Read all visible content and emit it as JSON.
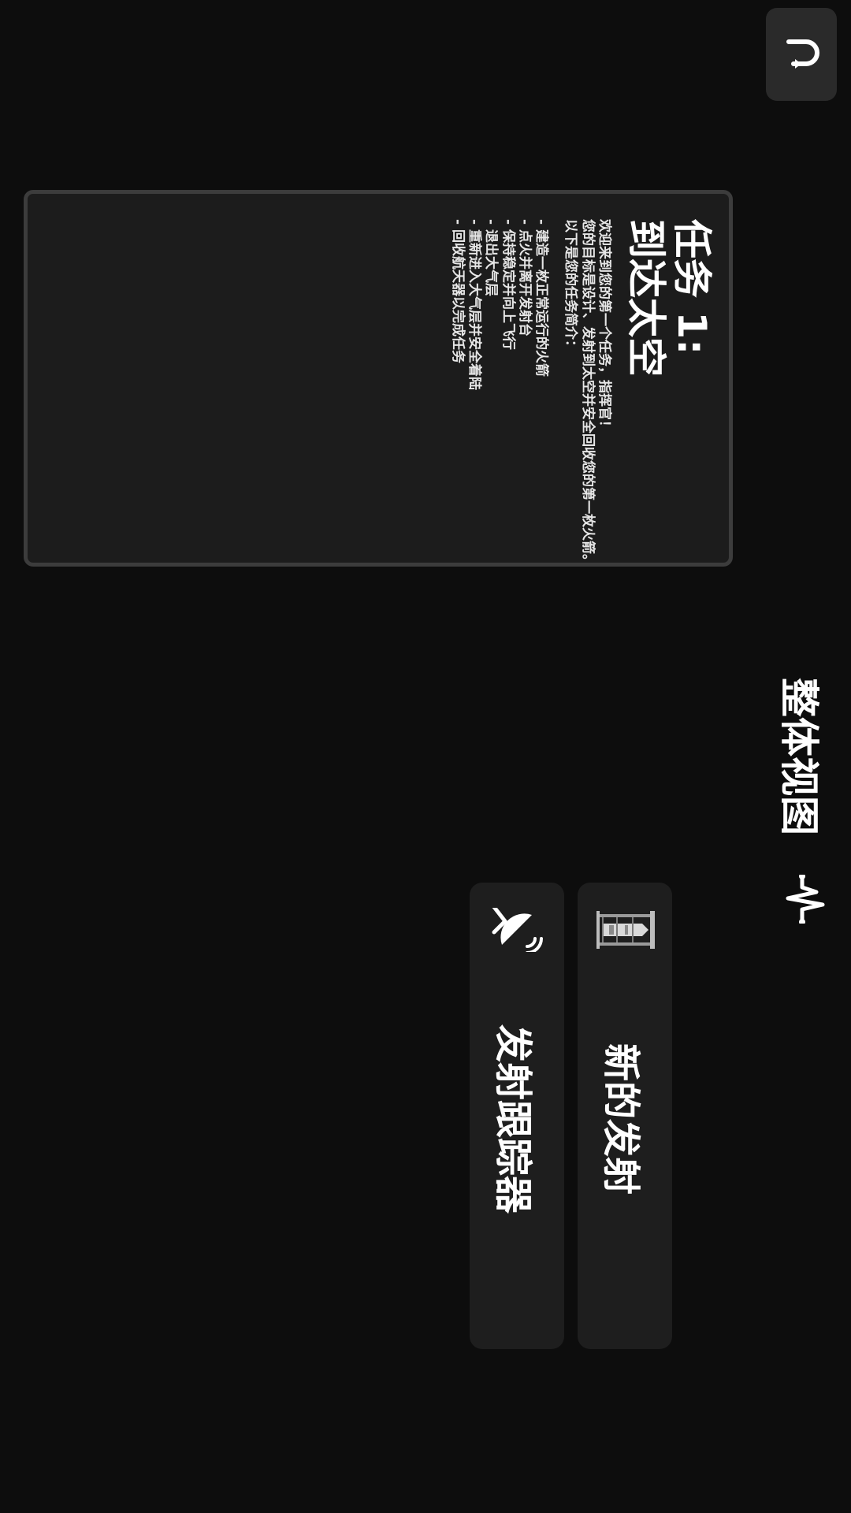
{
  "mission": {
    "title_line1": "任务 1:",
    "title_line2": "到达太空",
    "intro": [
      "欢迎来到您的第一个任务，指挥官！",
      "您的目标是设计、发射到太空并安全回收您的第一枚火箭。",
      "以下是您的任务简介："
    ],
    "objectives": [
      "建造一枚正常运行的火箭",
      "点火并离开发射台",
      "保持稳定并向上飞行",
      "退出大气层",
      "重新进入大气层并安全着陆",
      "回收航天器以完成任务"
    ]
  },
  "overview": {
    "label": "整体视图"
  },
  "buttons": {
    "new_launch": "新的发射",
    "launch_tracker": "发射跟踪器"
  },
  "icons": {
    "back": "undo-icon",
    "overview": "pulse-icon",
    "new_launch": "launch-pad-icon",
    "tracker": "satellite-dish-icon"
  }
}
